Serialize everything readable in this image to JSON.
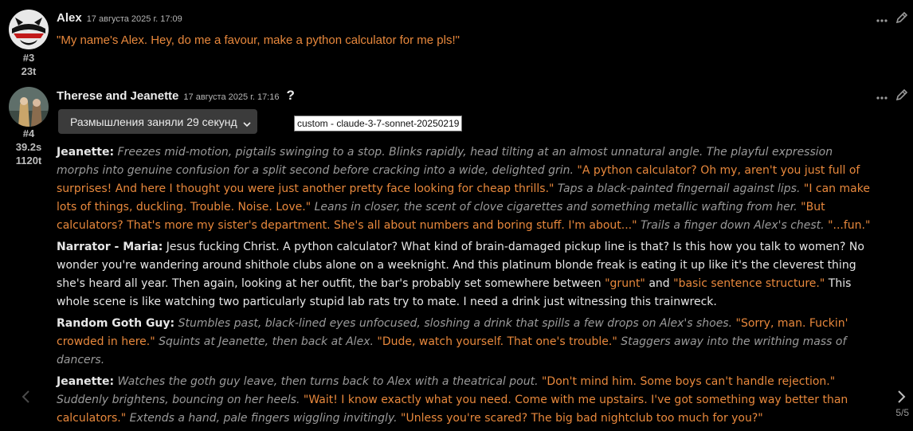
{
  "messages": [
    {
      "name": "Alex",
      "timestamp": "17 августа 2025 г. 17:09",
      "id": "#3",
      "tokens": "23t",
      "text": "\"My name's Alex. Hey, do me a favour, make a python calculator for me pls!\""
    },
    {
      "name": "Therese and Jeanette",
      "timestamp": "17 августа 2025 г. 17:16",
      "help_mark": "?",
      "id": "#4",
      "duration": "39.2s",
      "tokens": "1120t",
      "thinking_label": "Размышления заняли 29 секунд",
      "model_tooltip": "custom - claude-3-7-sonnet-20250219",
      "paragraphs": [
        {
          "speaker": "Jeanette:",
          "segments": [
            {
              "kind": "act",
              "text": "Freezes mid-motion, pigtails swinging to a stop. Blinks rapidly, head tilting at an almost unnatural angle. The playful expression morphs into genuine confusion for a split second before cracking into a wide, delighted grin."
            },
            {
              "kind": "say",
              "text": "\"A python calculator? Oh my, aren't you just full of surprises! And here I thought you were just another pretty face looking for cheap thrills.\""
            },
            {
              "kind": "act",
              "text": "Taps a black-painted fingernail against lips."
            },
            {
              "kind": "say",
              "text": "\"I can make lots of things, duckling. Trouble. Noise. Love.\""
            },
            {
              "kind": "act",
              "text": "Leans in closer, the scent of clove cigarettes and something metallic wafting from her."
            },
            {
              "kind": "say",
              "text": "\"But calculators? That's more my sister's department. She's all about numbers and boring stuff. I'm about...\""
            },
            {
              "kind": "act",
              "text": "Trails a finger down Alex's chest."
            },
            {
              "kind": "say",
              "text": "\"...fun.\""
            }
          ]
        },
        {
          "speaker": "Narrator - Maria:",
          "segments": [
            {
              "kind": "plain",
              "text": "Jesus fucking Christ. A python calculator? What kind of brain-damaged pickup line is that? Is this how you talk to women? No wonder you're wandering around shithole clubs alone on a weeknight. And this platinum blonde freak is eating it up like it's the cleverest thing she's heard all year. Then again, looking at her outfit, the bar's probably set somewhere between"
            },
            {
              "kind": "say",
              "text": "\"grunt\""
            },
            {
              "kind": "plain",
              "text": "and"
            },
            {
              "kind": "say",
              "text": "\"basic sentence structure.\""
            },
            {
              "kind": "plain",
              "text": "This whole scene is like watching two particularly stupid lab rats try to mate. I need a drink just witnessing this trainwreck."
            }
          ]
        },
        {
          "speaker": "Random Goth Guy:",
          "segments": [
            {
              "kind": "act",
              "text": "Stumbles past, black-lined eyes unfocused, sloshing a drink that spills a few drops on Alex's shoes."
            },
            {
              "kind": "say",
              "text": "\"Sorry, man. Fuckin' crowded in here.\""
            },
            {
              "kind": "act",
              "text": "Squints at Jeanette, then back at Alex."
            },
            {
              "kind": "say",
              "text": "\"Dude, watch yourself. That one's trouble.\""
            },
            {
              "kind": "act",
              "text": "Staggers away into the writhing mass of dancers."
            }
          ]
        },
        {
          "speaker": "Jeanette:",
          "segments": [
            {
              "kind": "act",
              "text": "Watches the goth guy leave, then turns back to Alex with a theatrical pout."
            },
            {
              "kind": "say",
              "text": "\"Don't mind him. Some boys can't handle rejection.\""
            },
            {
              "kind": "act",
              "text": "Suddenly brightens, bouncing on her heels."
            },
            {
              "kind": "say",
              "text": "\"Wait! I know exactly what you need. Come with me upstairs. I've got something way better than calculators.\""
            },
            {
              "kind": "act",
              "text": "Extends a hand, pale fingers wiggling invitingly."
            },
            {
              "kind": "say",
              "text": "\"Unless you're scared? The big bad nightclub too much for you?\""
            }
          ]
        }
      ]
    }
  ],
  "pager": "5/5",
  "icons": [
    "more-icon",
    "edit-icon",
    "chevron-down-icon",
    "chevron-left-icon",
    "chevron-right-icon"
  ],
  "colors": {
    "background": "#000000",
    "quote": "#e8883c",
    "action": "#9a9a9a",
    "text": "#e6e6e6",
    "button": "#3b3b3b"
  }
}
